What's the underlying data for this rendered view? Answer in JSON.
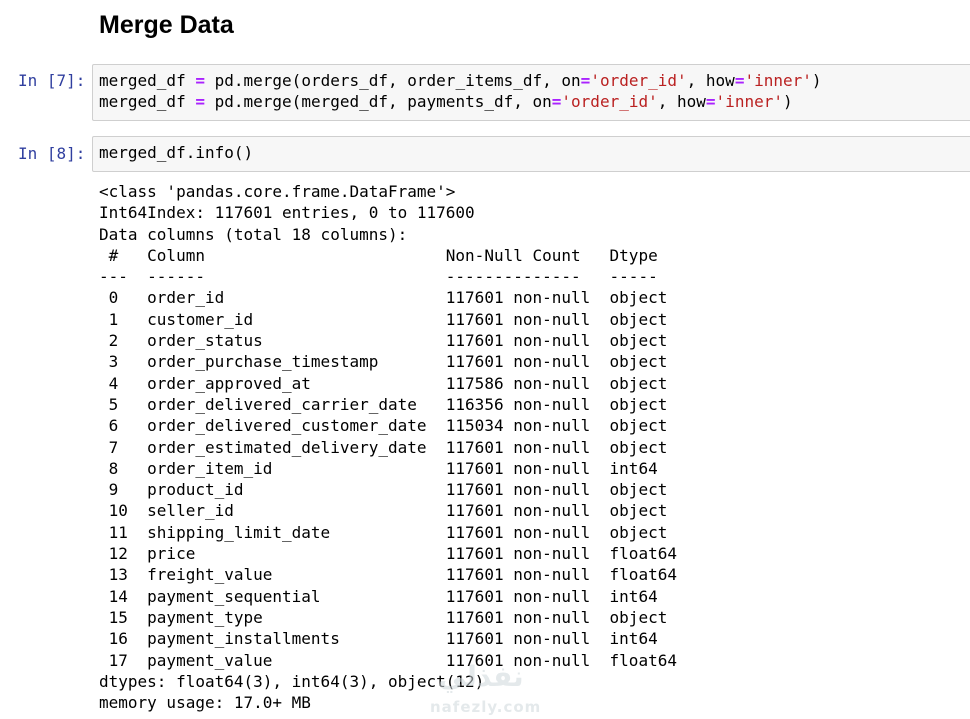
{
  "heading": "Merge Data",
  "cells": [
    {
      "prompt": "In [7]:",
      "lines": [
        [
          {
            "t": "merged_df",
            "k": "var"
          },
          {
            "t": " ",
            "k": "var"
          },
          {
            "t": "=",
            "k": "op"
          },
          {
            "t": " pd.merge(orders_df, order_items_df, on",
            "k": "var"
          },
          {
            "t": "=",
            "k": "op"
          },
          {
            "t": "'order_id'",
            "k": "str"
          },
          {
            "t": ", how",
            "k": "var"
          },
          {
            "t": "=",
            "k": "op"
          },
          {
            "t": "'inner'",
            "k": "str"
          },
          {
            "t": ")",
            "k": "var"
          }
        ],
        [
          {
            "t": "merged_df",
            "k": "var"
          },
          {
            "t": " ",
            "k": "var"
          },
          {
            "t": "=",
            "k": "op"
          },
          {
            "t": " pd.merge(merged_df, payments_df, on",
            "k": "var"
          },
          {
            "t": "=",
            "k": "op"
          },
          {
            "t": "'order_id'",
            "k": "str"
          },
          {
            "t": ", how",
            "k": "var"
          },
          {
            "t": "=",
            "k": "op"
          },
          {
            "t": "'inner'",
            "k": "str"
          },
          {
            "t": ")",
            "k": "var"
          }
        ]
      ]
    },
    {
      "prompt": "In [8]:",
      "lines": [
        [
          {
            "t": "merged_df.info()",
            "k": "var"
          }
        ]
      ]
    }
  ],
  "output_lines": [
    "<class 'pandas.core.frame.DataFrame'>",
    "Int64Index: 117601 entries, 0 to 117600",
    "Data columns (total 18 columns):",
    " #   Column                         Non-Null Count   Dtype  ",
    "---  ------                         --------------   -----  ",
    " 0   order_id                       117601 non-null  object ",
    " 1   customer_id                    117601 non-null  object ",
    " 2   order_status                   117601 non-null  object ",
    " 3   order_purchase_timestamp       117601 non-null  object ",
    " 4   order_approved_at              117586 non-null  object ",
    " 5   order_delivered_carrier_date   116356 non-null  object ",
    " 6   order_delivered_customer_date  115034 non-null  object ",
    " 7   order_estimated_delivery_date  117601 non-null  object ",
    " 8   order_item_id                  117601 non-null  int64  ",
    " 9   product_id                     117601 non-null  object ",
    " 10  seller_id                      117601 non-null  object ",
    " 11  shipping_limit_date            117601 non-null  object ",
    " 12  price                          117601 non-null  float64",
    " 13  freight_value                  117601 non-null  float64",
    " 14  payment_sequential             117601 non-null  int64  ",
    " 15  payment_type                   117601 non-null  object ",
    " 16  payment_installments           117601 non-null  int64  ",
    " 17  payment_value                  117601 non-null  float64",
    "dtypes: float64(3), int64(3), object(12)",
    "memory usage: 17.0+ MB"
  ],
  "watermark": {
    "arabic": "نفذلي",
    "latin": "nafezly.com"
  },
  "colors": {
    "prompt": "#303f9f",
    "operator": "#aa22ff",
    "string": "#ba2121",
    "cell_background": "#f7f7f7",
    "cell_border": "#cfcfcf"
  }
}
